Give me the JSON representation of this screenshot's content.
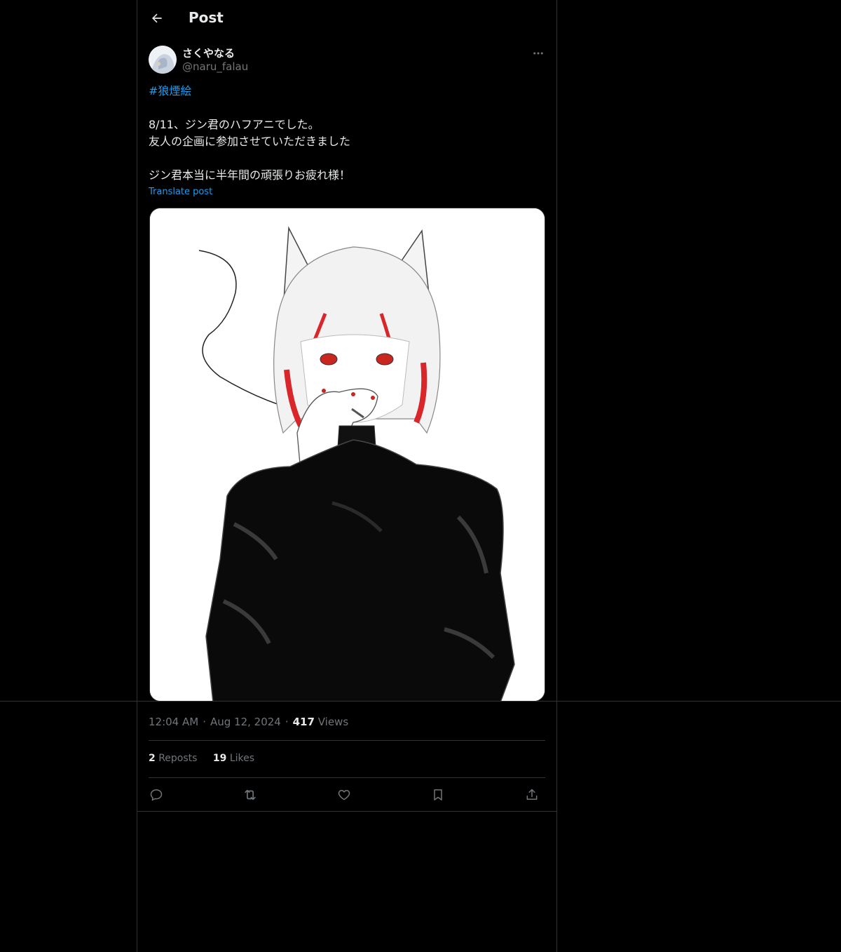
{
  "header": {
    "title": "Post"
  },
  "author": {
    "display_name": "さくやなる",
    "handle": "@naru_falau"
  },
  "post": {
    "hashtag": "#狼煙絵",
    "line1": "8/11、ジン君のハフアニでした。",
    "line2": "友人の企画に参加させていただきました",
    "line3": "ジン君本当に半年間の頑張りお疲れ様！",
    "translate_label": "Translate post"
  },
  "meta": {
    "time": "12:04 AM",
    "date": "Aug 12, 2024",
    "views_count": "417",
    "views_label": "Views"
  },
  "stats": {
    "reposts_count": "2",
    "reposts_label": "Reposts",
    "likes_count": "19",
    "likes_label": "Likes"
  },
  "icons": {
    "back": "arrow-left-icon",
    "more": "more-icon",
    "reply": "reply-icon",
    "repost": "repost-icon",
    "like": "heart-icon",
    "bookmark": "bookmark-icon",
    "share": "share-icon"
  },
  "colors": {
    "background": "#000000",
    "text": "#e7e9ea",
    "secondary": "#71767b",
    "accent": "#1d9bf0",
    "border": "#2f3336"
  }
}
